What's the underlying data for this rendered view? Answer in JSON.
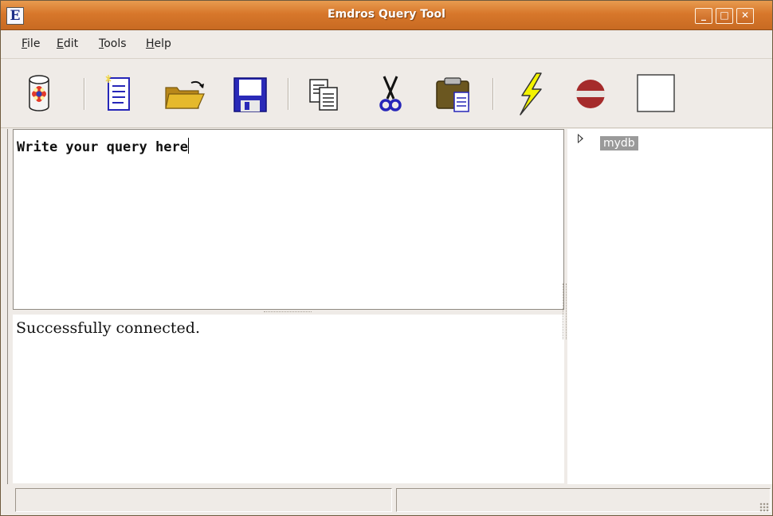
{
  "window": {
    "title": "Emdros Query Tool",
    "app_icon_letter": "E",
    "minimize": "_",
    "maximize": "□",
    "close": "✕"
  },
  "menu": [
    {
      "label_u": "F",
      "label_rest": "ile"
    },
    {
      "label_u": "E",
      "label_rest": "dit"
    },
    {
      "label_u": "T",
      "label_rest": "ools"
    },
    {
      "label_u": "H",
      "label_rest": "elp"
    }
  ],
  "toolbar": {
    "buttons": [
      "connect-icon",
      "new-document-icon",
      "open-folder-icon",
      "save-icon",
      "copy-icon",
      "cut-icon",
      "paste-icon",
      "execute-icon",
      "stop-icon",
      "blank-icon"
    ]
  },
  "query": {
    "text": "Write your query here"
  },
  "result": {
    "text": "Successfully connected."
  },
  "tree": {
    "node": "mydb"
  },
  "status": {
    "left": "",
    "right": ""
  },
  "colors": {
    "titlebar": "#d7772b",
    "icon_blue": "#2626b8",
    "folder": "#d4a320",
    "lightning": "#f3f300",
    "stop": "#a52b2b"
  }
}
